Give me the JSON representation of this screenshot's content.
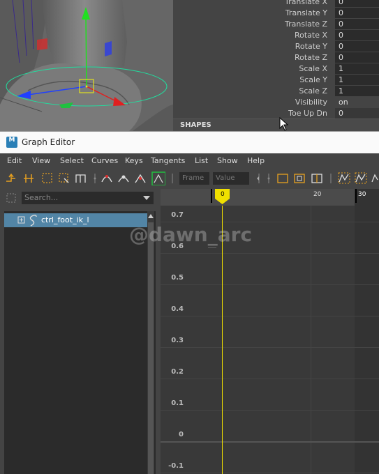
{
  "attributes": [
    {
      "label": "Translate X",
      "value": "0"
    },
    {
      "label": "Translate Y",
      "value": "0"
    },
    {
      "label": "Translate Z",
      "value": "0"
    },
    {
      "label": "Rotate X",
      "value": "0"
    },
    {
      "label": "Rotate Y",
      "value": "0"
    },
    {
      "label": "Rotate Z",
      "value": "0"
    },
    {
      "label": "Scale X",
      "value": "1"
    },
    {
      "label": "Scale Y",
      "value": "1"
    },
    {
      "label": "Scale Z",
      "value": "1"
    },
    {
      "label": "Visibility",
      "value": "on"
    },
    {
      "label": "Toe Up Dn",
      "value": "0"
    }
  ],
  "shapes_header": "SHAPES",
  "graph_editor": {
    "logo": "M",
    "title": "Graph Editor",
    "menu": [
      "Edit",
      "View",
      "Select",
      "Curves",
      "Keys",
      "Tangents",
      "List",
      "Show",
      "Help"
    ],
    "frame_placeholder": "Frame",
    "value_placeholder": "Value",
    "search_placeholder": "Search...",
    "outliner_item": "ctrl_foot_ik_l",
    "timeline_labels": [
      "0",
      "20",
      "30"
    ],
    "y_labels": [
      "0.7",
      "0.6",
      "0.5",
      "0.4",
      "0.3",
      "0.2",
      "0.1",
      "0",
      "-0.1"
    ],
    "current_frame": "0"
  },
  "watermark": "@dawn_arc",
  "colors": {
    "accent_select": "#5285a6",
    "current_time": "#f0e000",
    "manip_x": "#e02020",
    "manip_y": "#20e020",
    "manip_z": "#2040ff",
    "rotate_ring": "#20e0a0"
  }
}
